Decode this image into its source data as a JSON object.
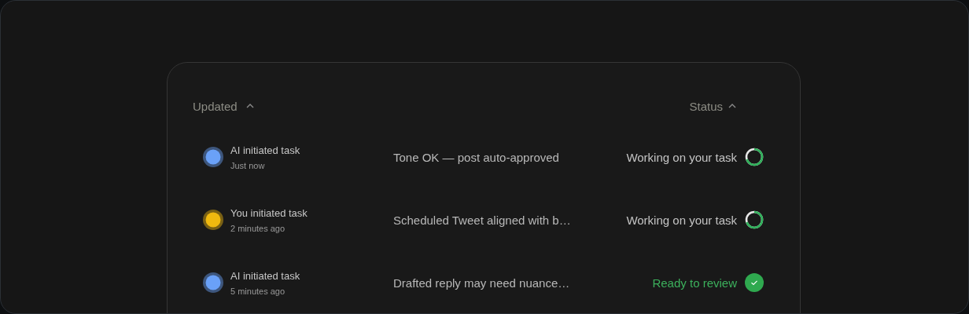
{
  "table": {
    "columns": [
      {
        "label": "Updated",
        "sorted_ascending": true
      },
      {
        "label": "Status",
        "sorted_ascending": true
      }
    ],
    "rows": [
      {
        "initiator": "AI initiated task",
        "time": "Just now",
        "color": "#6aa1f8",
        "summary": "Tone OK — post auto-approved",
        "status": {
          "kind": "working",
          "label": "Working on your task"
        }
      },
      {
        "initiator": "You initiated task",
        "time": "2 minutes ago",
        "color": "#f0b90f",
        "summary": "Scheduled Tweet aligned with b…",
        "status": {
          "kind": "working",
          "label": "Working on your task"
        }
      },
      {
        "initiator": "AI initiated task",
        "time": "5 minutes ago",
        "color": "#6aa1f8",
        "summary": "Drafted reply may need nuance…",
        "status": {
          "kind": "ready",
          "label": "Ready to review"
        }
      }
    ]
  }
}
